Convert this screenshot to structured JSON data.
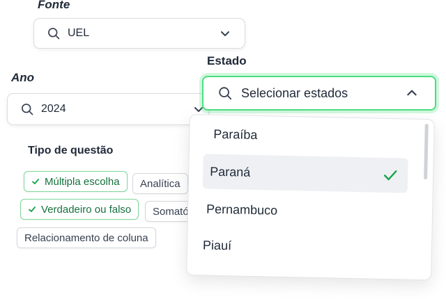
{
  "fonte": {
    "label": "Fonte",
    "value": "UEL"
  },
  "ano": {
    "label": "Ano",
    "value": "2024"
  },
  "estado": {
    "label": "Estado",
    "placeholder": "Selecionar estados",
    "options": [
      {
        "label": "Paraíba",
        "selected": false
      },
      {
        "label": "Paraná",
        "selected": true
      },
      {
        "label": "Pernambuco",
        "selected": false
      },
      {
        "label": "Piauí",
        "selected": false
      }
    ]
  },
  "tipo": {
    "label": "Tipo de questão",
    "chips": [
      {
        "label": "Múltipla escolha",
        "selected": true
      },
      {
        "label": "Analítica",
        "selected": false
      },
      {
        "label": "Verdadeiro ou falso",
        "selected": true
      },
      {
        "label": "Somatória",
        "selected": false
      },
      {
        "label": "Relacionamento de coluna",
        "selected": false
      }
    ]
  },
  "colors": {
    "accent": "#4ade80",
    "check": "#16a34a",
    "text": "#1f2937"
  }
}
